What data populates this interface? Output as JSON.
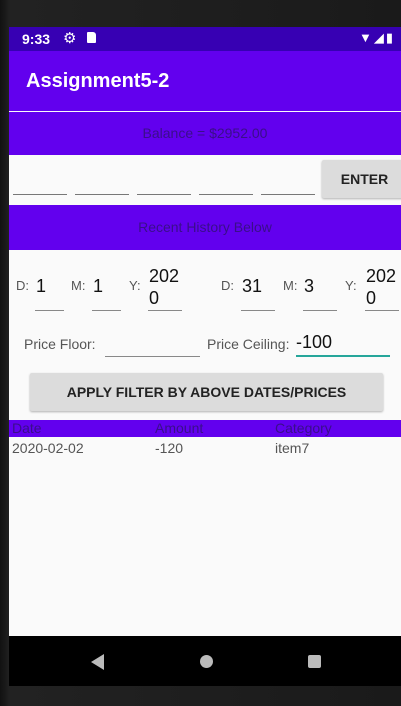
{
  "status_bar": {
    "time": "9:33",
    "icons": [
      "gear-icon",
      "sd-card-icon",
      "wifi-icon",
      "signal-icon",
      "battery-icon"
    ]
  },
  "app_bar": {
    "title": "Assignment5-2"
  },
  "balance": {
    "text": "Balance = $2952.00"
  },
  "entry": {
    "fields": [
      "",
      "",
      "",
      "",
      ""
    ],
    "enter_label": "ENTER"
  },
  "history_banner": {
    "text": "Recent History Below"
  },
  "date_filter": {
    "from": {
      "d_label": "D:",
      "d_value": "1",
      "m_label": "M:",
      "m_value": "1",
      "y_label": "Y:",
      "y_value_line1": "202",
      "y_value_line2": "0"
    },
    "to": {
      "d_label": "D:",
      "d_value": "31",
      "m_label": "M:",
      "m_value": "3",
      "y_label": "Y:",
      "y_value_line1": "202",
      "y_value_line2": "0"
    }
  },
  "price_filter": {
    "floor_label": "Price Floor:",
    "floor_value": "",
    "ceiling_label": "Price Ceiling:",
    "ceiling_value": "-100"
  },
  "apply_button": {
    "label": "APPLY FILTER BY ABOVE DATES/PRICES"
  },
  "table": {
    "headers": [
      "Date",
      "Amount",
      "Category"
    ],
    "rows": [
      [
        "2020-02-02",
        "-120",
        "item7"
      ]
    ]
  },
  "colors": {
    "primary": "#6200ee",
    "primary_dark": "#3700b3",
    "accent": "#26a69a"
  }
}
